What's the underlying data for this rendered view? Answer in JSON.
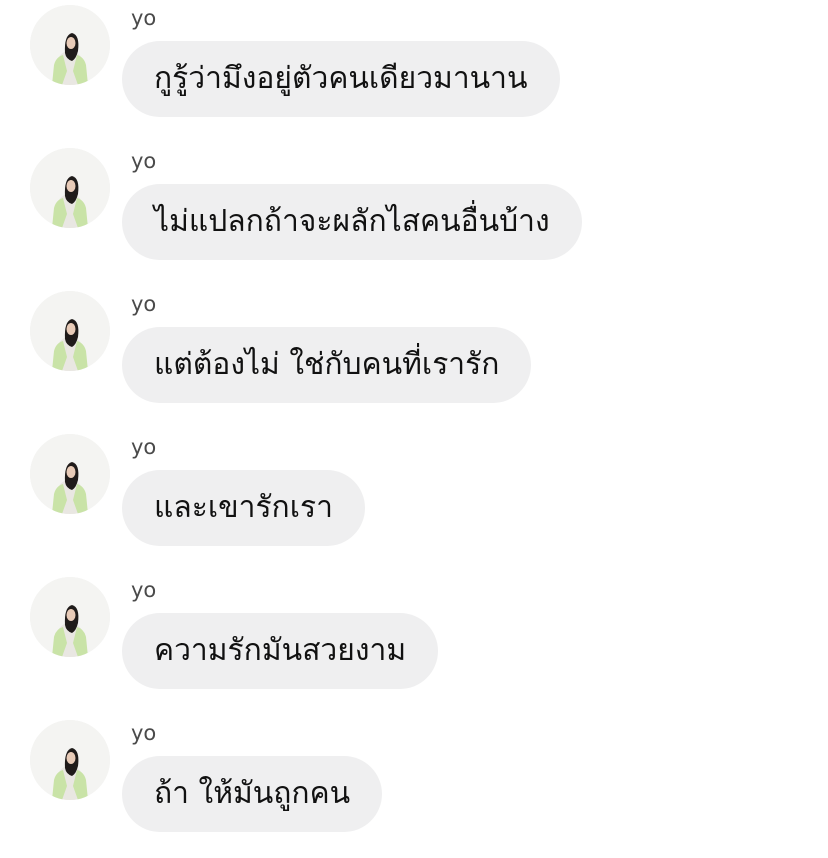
{
  "messages": [
    {
      "sender": "yo",
      "text": "กูรู้ว่ามึงอยู่ตัวคนเดียวมานาน",
      "avatar_icon": "profile-photo"
    },
    {
      "sender": "yo",
      "text": "ไม่แปลกถ้าจะผลักไสคนอื่นบ้าง",
      "avatar_icon": "profile-photo"
    },
    {
      "sender": "yo",
      "text": "แต่ต้องไม่ ใช่กับคนที่เรารัก",
      "avatar_icon": "profile-photo"
    },
    {
      "sender": "yo",
      "text": "และเขารักเรา",
      "avatar_icon": "profile-photo"
    },
    {
      "sender": "yo",
      "text": "ความรักมันสวยงาม",
      "avatar_icon": "profile-photo"
    },
    {
      "sender": "yo",
      "text": "ถ้า ให้มันถูกคน",
      "avatar_icon": "profile-photo"
    }
  ],
  "colors": {
    "background": "#ffffff",
    "bubble": "#efeff0",
    "text": "#111111",
    "sender_name": "#4a4a4a",
    "avatar_jacket": "#c9e3a7"
  }
}
